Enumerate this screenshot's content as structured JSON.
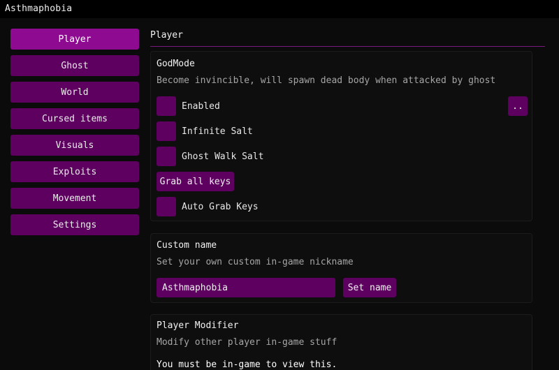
{
  "window": {
    "title": "Asthmaphobia"
  },
  "sidebar": {
    "items": [
      {
        "label": "Player",
        "active": true
      },
      {
        "label": "Ghost"
      },
      {
        "label": "World"
      },
      {
        "label": "Cursed items"
      },
      {
        "label": "Visuals"
      },
      {
        "label": "Exploits"
      },
      {
        "label": "Movement"
      },
      {
        "label": "Settings"
      }
    ]
  },
  "main": {
    "section_title": "Player",
    "godmode": {
      "title": "GodMode",
      "description": "Become invincible, will spawn dead body when attacked by ghost",
      "enabled_label": "Enabled",
      "more_button": "..",
      "infinite_salt_label": "Infinite Salt",
      "ghost_walk_salt_label": "Ghost Walk Salt",
      "grab_keys_button": "Grab all keys",
      "auto_grab_label": "Auto Grab Keys"
    },
    "custom_name": {
      "title": "Custom name",
      "description": "Set your own custom in-game nickname",
      "input_value": "Asthmaphobia",
      "set_button": "Set name"
    },
    "player_modifier": {
      "title": "Player Modifier",
      "description": "Modify other player in-game stuff",
      "notice": "You must be in-game to view this."
    }
  },
  "colors": {
    "accent": "#5d0060",
    "accent_active": "#8e0a91",
    "background": "#0b0b0b",
    "separator": "#7a1a80"
  }
}
